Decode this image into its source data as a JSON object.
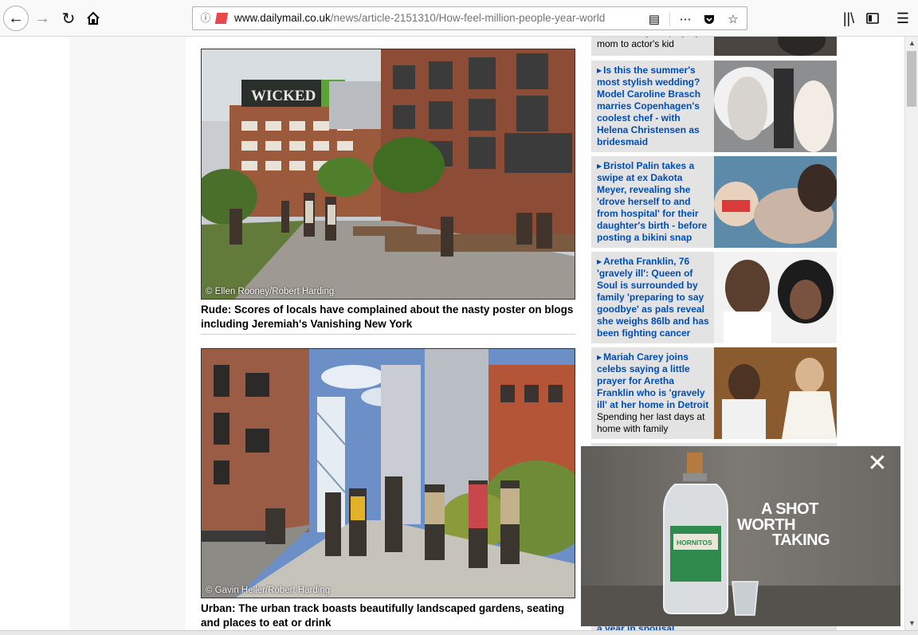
{
  "browser": {
    "url_host": "www.dailymail.co.uk",
    "url_path": "/news/article-2151310/How-feel-million-people-year-world",
    "icons": [
      "back-icon",
      "forward-icon",
      "reload-icon",
      "home-icon",
      "info-icon",
      "permissions-icon",
      "reader-view-icon",
      "page-actions-icon",
      "pocket-icon",
      "bookmark-star-icon",
      "library-icon",
      "sidebar-icon",
      "menu-icon"
    ]
  },
  "article": {
    "photo1_credit": "© Ellen Rooney/Robert Harding",
    "photo1_sign": "WICKED",
    "caption1": "Rude: Scores of locals have complained about the nasty poster on blogs including Jeremiah's Vanishing New York",
    "photo2_credit": "© Gavin Heller/Robert Harding",
    "caption2": "Urban: The urban track boasts beautifully landscaped gardens, seating and places to eat or drink"
  },
  "rail": {
    "items": [
      {
        "headline": "",
        "subtext": "Arnie's daughter playing mom to actor's kid"
      },
      {
        "headline": "Is this the summer's most stylish wedding? Model Caroline Brasch marries Copenhagen's coolest chef - with Helena Christensen as bridesmaid",
        "subtext": ""
      },
      {
        "headline": "Bristol Palin takes a swipe at ex Dakota Meyer, revealing she 'drove herself to and from hospital' for their daughter's birth - before posting a bikini snap",
        "subtext": ""
      },
      {
        "headline": "Aretha Franklin, 76 'gravely ill': Queen of Soul is surrounded by family 'preparing to say goodbye' as pals reveal she weighs 86lb and has been fighting cancer",
        "subtext": ""
      },
      {
        "headline": "Mariah Carey joins celebs saying a little prayer for Aretha Franklin who is 'gravely ill' at her home in Detroit",
        "subtext": "Spending her last days at home with family"
      }
    ],
    "partial_bottom": "a year in spousal"
  },
  "ad": {
    "line1": "A SHOT",
    "line2": "WORTH",
    "line3": "TAKING",
    "brand": "HORNITOS",
    "close_label": "✕"
  },
  "colors": {
    "headline_blue": "#004db3",
    "rail_bg": "#e3e3e3",
    "caption_text": "#000000"
  }
}
